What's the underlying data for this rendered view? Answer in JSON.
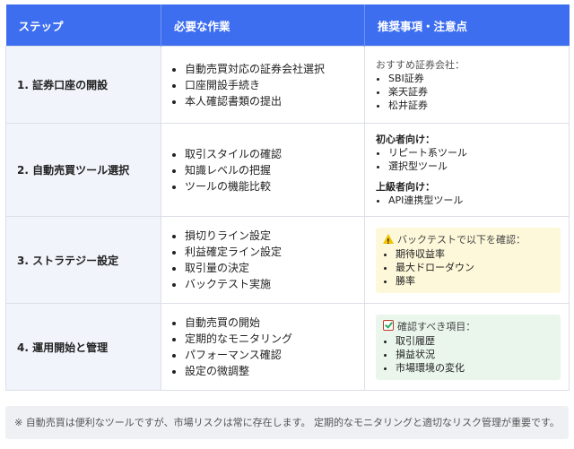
{
  "table": {
    "headers": [
      "ステップ",
      "必要な作業",
      "推奨事項・注意点"
    ],
    "rows": [
      {
        "step": "1. 証券口座の開設",
        "tasks": [
          "自動売買対応の証券会社選択",
          "口座開設手続き",
          "本人確認書類の提出"
        ],
        "note": {
          "title": "おすすめ証券会社：",
          "items": [
            "SBI証券",
            "楽天証券",
            "松井証券"
          ]
        }
      },
      {
        "step": "2. 自動売買ツール選択",
        "tasks": [
          "取引スタイルの確認",
          "知識レベルの把握",
          "ツールの機能比較"
        ],
        "note": {
          "group1_title": "初心者向け：",
          "group1_items": [
            "リピート系ツール",
            "選択型ツール"
          ],
          "group2_title": "上級者向け：",
          "group2_items": [
            "API連携型ツール"
          ]
        }
      },
      {
        "step": "3. ストラテジー設定",
        "tasks": [
          "損切りライン設定",
          "利益確定ライン設定",
          "取引量の決定",
          "バックテスト実施"
        ],
        "note": {
          "icon": "warning-icon",
          "title": "バックテストで以下を確認：",
          "items": [
            "期待収益率",
            "最大ドローダウン",
            "勝率"
          ]
        }
      },
      {
        "step": "4. 運用開始と管理",
        "tasks": [
          "自動売買の開始",
          "定期的なモニタリング",
          "パフォーマンス確認",
          "設定の微調整"
        ],
        "note": {
          "icon": "checklist-icon",
          "title": "確認すべき項目：",
          "items": [
            "取引履歴",
            "損益状況",
            "市場環境の変化"
          ]
        }
      }
    ]
  },
  "footer": "※ 自動売買は便利なツールですが、市場リスクは常に存在します。 定期的なモニタリングと適切なリスク管理が重要です。",
  "colors": {
    "header_bg": "#3d6ef0",
    "step_bg": "#f1f4fb",
    "warning_box": "#fdf8d9",
    "check_box": "#eaf6ec"
  }
}
